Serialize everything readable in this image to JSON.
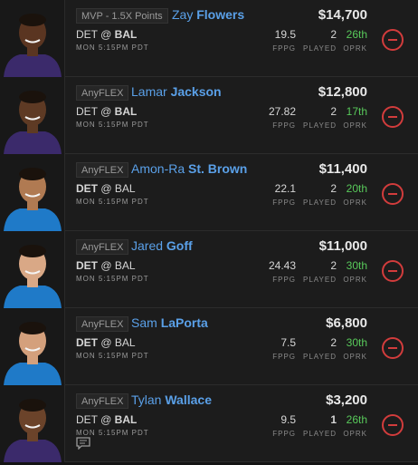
{
  "colors": {
    "background": "#1c1c1c",
    "name_blue": "#5aa0e8",
    "oprk_green": "#58c95a",
    "remove_red": "#d23c3c"
  },
  "labels": {
    "fppg": "FPPG",
    "played": "PLAYED",
    "oprk": "OPRK"
  },
  "players": [
    {
      "slot": "MVP - 1.5X Points",
      "first": "Zay",
      "last": "Flowers",
      "salary": "$14,700",
      "game_away": "DET",
      "game_at": "@",
      "game_home": "BAL",
      "time": "MON 5:15PM PDT",
      "fppg": "19.5",
      "played": "2",
      "oprk": "26th",
      "bold_team": "BAL",
      "jersey_color": "#3b2a6b",
      "skin": "#5a3521",
      "icon": "player-headshot"
    },
    {
      "slot": "AnyFLEX",
      "first": "Lamar",
      "last": "Jackson",
      "salary": "$12,800",
      "game_away": "DET",
      "game_at": "@",
      "game_home": "BAL",
      "time": "MON 5:15PM PDT",
      "fppg": "27.82",
      "played": "2",
      "oprk": "17th",
      "bold_team": "BAL",
      "jersey_color": "#3b2a6b",
      "skin": "#5e3a24",
      "icon": "player-headshot"
    },
    {
      "slot": "AnyFLEX",
      "first": "Amon-Ra",
      "last": "St. Brown",
      "salary": "$11,400",
      "game_away": "DET",
      "game_at": "@",
      "game_home": "BAL",
      "time": "MON 5:15PM PDT",
      "fppg": "22.1",
      "played": "2",
      "oprk": "20th",
      "bold_team": "DET",
      "jersey_color": "#1f7ac8",
      "skin": "#b07a52",
      "icon": "player-headshot"
    },
    {
      "slot": "AnyFLEX",
      "first": "Jared",
      "last": "Goff",
      "salary": "$11,000",
      "game_away": "DET",
      "game_at": "@",
      "game_home": "BAL",
      "time": "MON 5:15PM PDT",
      "fppg": "24.43",
      "played": "2",
      "oprk": "30th",
      "bold_team": "DET",
      "jersey_color": "#1f7ac8",
      "skin": "#d9a886",
      "icon": "player-headshot"
    },
    {
      "slot": "AnyFLEX",
      "first": "Sam",
      "last": "LaPorta",
      "salary": "$6,800",
      "game_away": "DET",
      "game_at": "@",
      "game_home": "BAL",
      "time": "MON 5:15PM PDT",
      "fppg": "7.5",
      "played": "2",
      "oprk": "30th",
      "bold_team": "DET",
      "jersey_color": "#1f7ac8",
      "skin": "#d4a07c",
      "icon": "player-headshot"
    },
    {
      "slot": "AnyFLEX",
      "first": "Tylan",
      "last": "Wallace",
      "salary": "$3,200",
      "game_away": "DET",
      "game_at": "@",
      "game_home": "BAL",
      "time": "MON 5:15PM PDT",
      "fppg": "9.5",
      "played": "1",
      "oprk": "26th",
      "bold_team": "BAL",
      "bold_played": true,
      "has_note": true,
      "jersey_color": "#3b2a6b",
      "skin": "#6b432a",
      "icon": "player-headshot"
    }
  ]
}
